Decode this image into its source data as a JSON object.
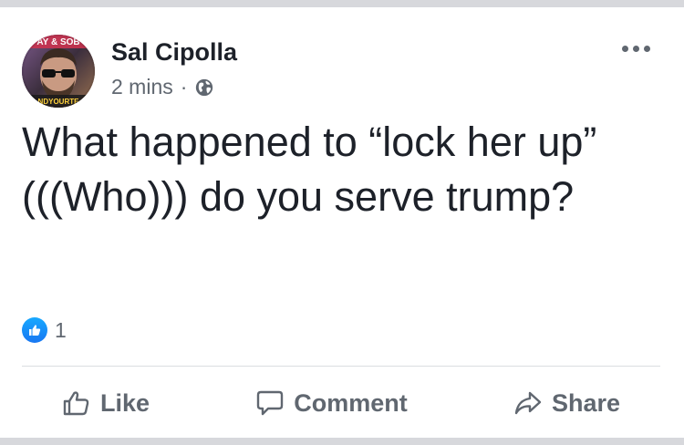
{
  "post": {
    "author": "Sal Cipolla",
    "time": "2 mins",
    "separator": "·",
    "privacy_icon": "globe-icon",
    "text_lines": [
      "What happened to “lock her up”",
      "(((Who))) do you serve trump?"
    ],
    "avatar_overlay": {
      "top_text": "AY & SOB",
      "bottom_text": "NDYOURTE"
    }
  },
  "reactions": {
    "icon": "like-reaction-icon",
    "count": "1"
  },
  "actions": {
    "like": "Like",
    "comment": "Comment",
    "share": "Share"
  },
  "colors": {
    "text": "#1d2129",
    "secondary": "#606770",
    "like_blue": "#1877f2",
    "divider": "#dadde1",
    "frame": "#d7d8dc"
  }
}
